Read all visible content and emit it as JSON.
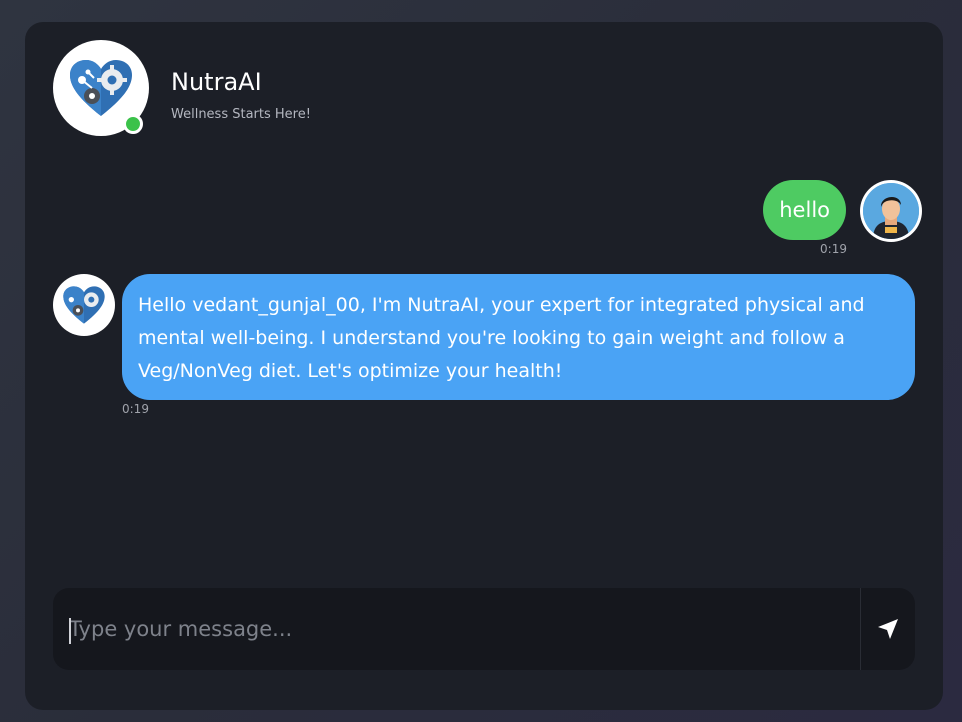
{
  "header": {
    "title": "NutraAI",
    "subtitle": "Wellness Starts Here!",
    "logo_icon": "heart-gears-icon",
    "status": "online",
    "status_color": "#3bc24a"
  },
  "messages": [
    {
      "sender": "user",
      "text": "hello",
      "time": "0:19",
      "bubble_color": "#4ecb62",
      "avatar_icon": "user-avatar-icon"
    },
    {
      "sender": "bot",
      "text": "Hello vedant_gunjal_00, I'm NutraAI, your expert for integrated physical and mental well-being. I understand you're looking to gain weight and follow a Veg/NonVeg diet. Let's optimize your health!",
      "time": "0:19",
      "bubble_color": "#4aa3f5",
      "avatar_icon": "heart-gears-icon"
    }
  ],
  "composer": {
    "placeholder": "Type your message...",
    "value": "",
    "send_icon": "send-arrow-icon"
  }
}
